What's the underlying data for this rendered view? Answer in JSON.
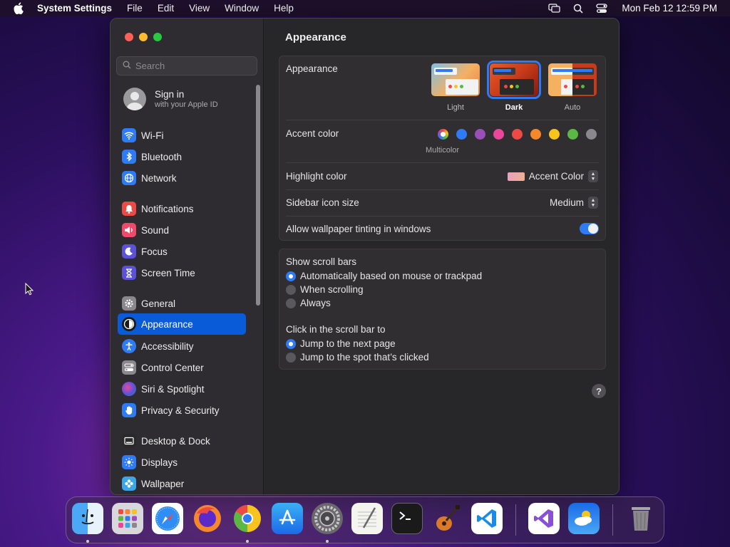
{
  "menubar": {
    "app": "System Settings",
    "items": [
      "File",
      "Edit",
      "View",
      "Window",
      "Help"
    ],
    "clock": "Mon Feb 12  12:59 PM"
  },
  "sidebar": {
    "search_placeholder": "Search",
    "signin_title": "Sign in",
    "signin_subtitle": "with your Apple ID",
    "items": [
      {
        "label": "Wi-Fi",
        "icon": "wifi-icon",
        "color": "#2f7bf5"
      },
      {
        "label": "Bluetooth",
        "icon": "bluetooth-icon",
        "color": "#2f7bf5"
      },
      {
        "label": "Network",
        "icon": "globe-icon",
        "color": "#2f7bf5"
      },
      {
        "label": "Notifications",
        "icon": "bell-icon",
        "color": "#ee4a45"
      },
      {
        "label": "Sound",
        "icon": "speaker-icon",
        "color": "#ee4a6a"
      },
      {
        "label": "Focus",
        "icon": "moon-icon",
        "color": "#5b52d8"
      },
      {
        "label": "Screen Time",
        "icon": "hourglass-icon",
        "color": "#5b52d8"
      },
      {
        "label": "General",
        "icon": "gear-icon",
        "color": "#8a888c"
      },
      {
        "label": "Appearance",
        "icon": "appearance-icon",
        "color": "#1a1a1a"
      },
      {
        "label": "Accessibility",
        "icon": "accessibility-icon",
        "color": "#2f7bf5"
      },
      {
        "label": "Control Center",
        "icon": "control-center-icon",
        "color": "#8a888c"
      },
      {
        "label": "Siri & Spotlight",
        "icon": "siri-icon",
        "color": "#3a2a5a"
      },
      {
        "label": "Privacy & Security",
        "icon": "hand-icon",
        "color": "#2f7bf5"
      },
      {
        "label": "Desktop & Dock",
        "icon": "dock-icon",
        "color": "#2a2a2a"
      },
      {
        "label": "Displays",
        "icon": "sun-icon",
        "color": "#2f7bf5"
      },
      {
        "label": "Wallpaper",
        "icon": "flower-icon",
        "color": "#3aa8e8"
      }
    ],
    "active": "Appearance"
  },
  "main": {
    "title": "Appearance",
    "appearance_label": "Appearance",
    "modes": [
      "Light",
      "Dark",
      "Auto"
    ],
    "selected_mode": "Dark",
    "accent_label": "Accent color",
    "accent_colors": [
      "#ffffff",
      "#2f7bf5",
      "#9a4fb8",
      "#e8479a",
      "#ee4a45",
      "#f5882a",
      "#f7c31f",
      "#5cb845",
      "#8a888c"
    ],
    "multicolor_label": "Multicolor",
    "highlight_label": "Highlight color",
    "highlight_value": "Accent Color",
    "icon_size_label": "Sidebar icon size",
    "icon_size_value": "Medium",
    "tinting_label": "Allow wallpaper tinting in windows",
    "tinting_on": true,
    "scrollbars_label": "Show scroll bars",
    "scrollbar_options": [
      "Automatically based on mouse or trackpad",
      "When scrolling",
      "Always"
    ],
    "scrollbar_selected": 0,
    "click_label": "Click in the scroll bar to",
    "click_options": [
      "Jump to the next page",
      "Jump to the spot that’s clicked"
    ],
    "click_selected": 0
  },
  "dock": {
    "apps": [
      "finder-icon",
      "launchpad-icon",
      "safari-icon",
      "firefox-icon",
      "chrome-icon",
      "app-store-icon",
      "system-settings-icon",
      "textedit-icon",
      "terminal-icon",
      "garageband-icon",
      "vscode-icon",
      "visual-studio-icon",
      "weather-icon",
      "trash-icon"
    ]
  }
}
